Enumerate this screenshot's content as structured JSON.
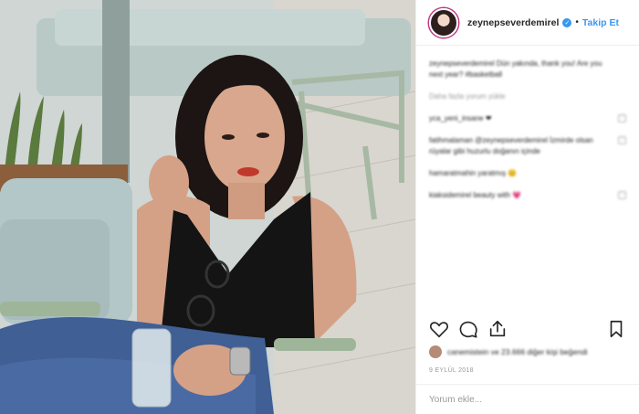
{
  "post": {
    "username": "zeynepseverdemirel",
    "separator": "•",
    "follow_label": "Takip Et"
  },
  "comments": [
    {
      "text": "zeynepseverdemirel Dün yakında, thank you! Are you next year? #basketball"
    },
    {
      "text": "Daha fazla yorum yükle"
    },
    {
      "text": "yca_yeni_insane ❤"
    },
    {
      "text": "fatihmalaman @zeynepseverdemirel İzmirde olsan rüyalar gibi huzurlu doğanın içinde"
    },
    {
      "text": "hamaratmahin yaratmış 😊"
    },
    {
      "text": "kiaksidemirel beauty with 💗"
    }
  ],
  "likes_text": "canemistein ve 23.666 diğer kişi beğendi",
  "date": "9 EYLÜL 2018",
  "comment_input": {
    "placeholder": "Yorum ekle..."
  },
  "icons": [
    "heart-icon",
    "comment-icon",
    "share-icon",
    "bookmark-icon",
    "verified-badge-icon"
  ],
  "colors": {
    "accent": "#3897f0",
    "text": "#262626",
    "muted": "#999999",
    "border": "#efefef"
  }
}
